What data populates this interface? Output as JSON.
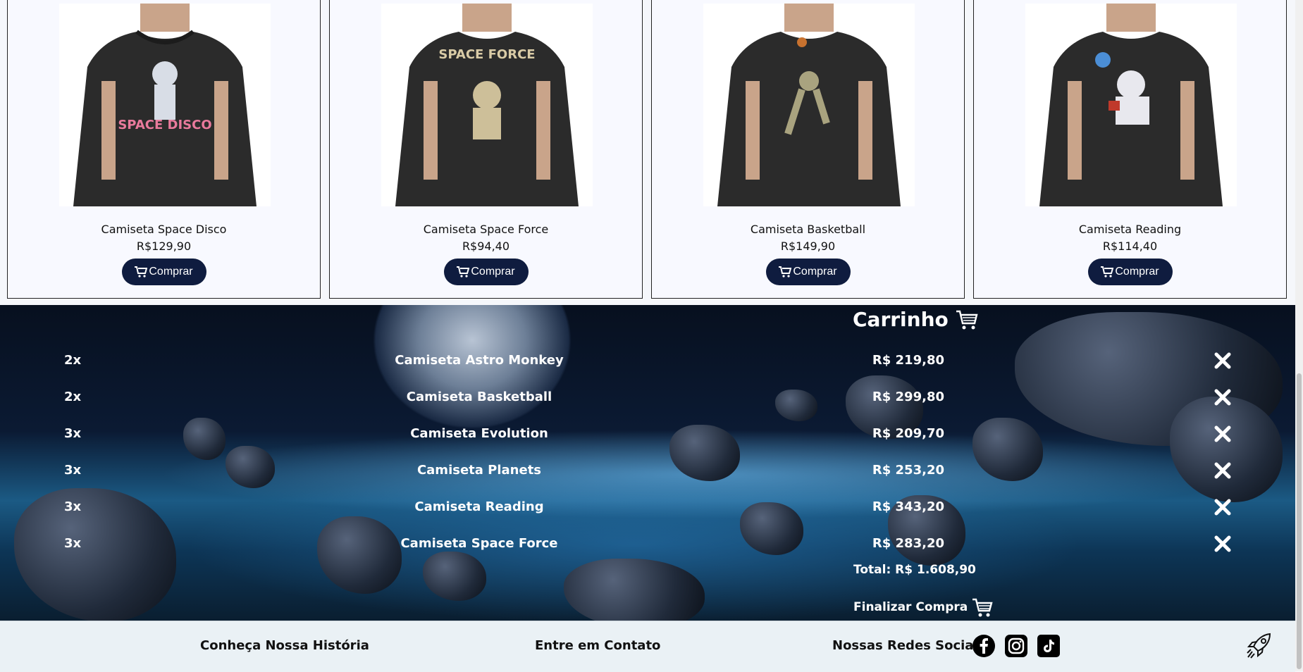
{
  "products": [
    {
      "name": "Camiseta Space Disco",
      "price": "R$129,90",
      "buy_label": "Comprar",
      "print": "SPACE DISCO"
    },
    {
      "name": "Camiseta Space Force",
      "price": "R$94,40",
      "buy_label": "Comprar",
      "print": "SPACE FORCE"
    },
    {
      "name": "Camiseta Basketball",
      "price": "R$149,90",
      "buy_label": "Comprar",
      "print": ""
    },
    {
      "name": "Camiseta Reading",
      "price": "R$114,40",
      "buy_label": "Comprar",
      "print": ""
    }
  ],
  "cart": {
    "title": "Carrinho",
    "items": [
      {
        "qty": "2x",
        "name": "Camiseta Astro Monkey",
        "total": "R$ 219,80"
      },
      {
        "qty": "2x",
        "name": "Camiseta Basketball",
        "total": "R$ 299,80"
      },
      {
        "qty": "3x",
        "name": "Camiseta Evolution",
        "total": "R$ 209,70"
      },
      {
        "qty": "3x",
        "name": "Camiseta Planets",
        "total": "R$ 253,20"
      },
      {
        "qty": "3x",
        "name": "Camiseta Reading",
        "total": "R$ 343,20"
      },
      {
        "qty": "3x",
        "name": "Camiseta Space Force",
        "total": "R$ 283,20"
      }
    ],
    "total": "Total: R$ 1.608,90",
    "checkout_label": "Finalizar Compra"
  },
  "footer": {
    "history": "Conheça Nossa História",
    "contact": "Entre em Contato",
    "social_title": "Nossas Redes Sociais",
    "social_icons": [
      "facebook-icon",
      "instagram-icon",
      "tiktok-icon"
    ]
  },
  "colors": {
    "button": "#0f1c3f",
    "footer": "#eaf1f5"
  }
}
